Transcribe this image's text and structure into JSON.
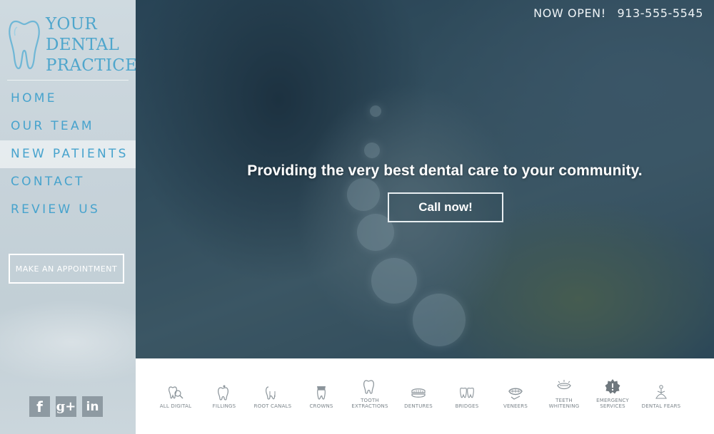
{
  "logo": {
    "line1": "YOUR",
    "line2": "DENTAL",
    "line3": "PRACTICE"
  },
  "nav": [
    {
      "label": "HOME"
    },
    {
      "label": "OUR TEAM"
    },
    {
      "label": "NEW PATIENTS"
    },
    {
      "label": "CONTACT"
    },
    {
      "label": "REVIEW US"
    }
  ],
  "appointment_button": "MAKE AN APPOINTMENT",
  "social": {
    "facebook": "f",
    "googleplus": "g+",
    "linkedin": "in"
  },
  "hero": {
    "status": "NOW OPEN!",
    "phone": "913-555-5545",
    "headline": "Providing the very best dental care to your community.",
    "cta": "Call now!"
  },
  "services": [
    {
      "label": "ALL DIGITAL",
      "icon": "all-digital-icon"
    },
    {
      "label": "FILLINGS",
      "icon": "fillings-icon"
    },
    {
      "label": "ROOT CANALS",
      "icon": "root-canals-icon"
    },
    {
      "label": "CROWNS",
      "icon": "crowns-icon"
    },
    {
      "label": "TOOTH\nEXTRACTIONS",
      "icon": "tooth-extraction-icon"
    },
    {
      "label": "DENTURES",
      "icon": "dentures-icon"
    },
    {
      "label": "BRIDGES",
      "icon": "bridges-icon"
    },
    {
      "label": "VENEERS",
      "icon": "veneers-icon"
    },
    {
      "label": "TEETH\nWHITENING",
      "icon": "teeth-whitening-icon"
    },
    {
      "label": "EMERGENCY\nSERVICES",
      "icon": "emergency-services-icon"
    },
    {
      "label": "DENTAL FEARS",
      "icon": "dental-fears-icon"
    }
  ],
  "colors": {
    "accent": "#47a3cd",
    "hero_overlay": "#1c3a4e",
    "service_text": "#7c858b"
  }
}
